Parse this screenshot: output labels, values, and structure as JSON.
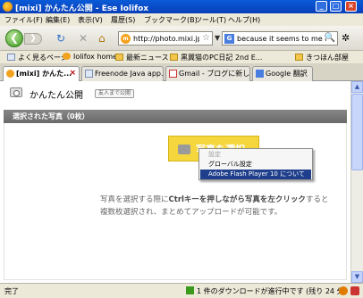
{
  "window": {
    "title": "[mixi] かんたん公開 - Ese Iolifox",
    "minimize_glyph": "_",
    "maximize_glyph": "□",
    "close_glyph": "×"
  },
  "menubar": [
    "ファイル(F)",
    "編集(E)",
    "表示(V)",
    "履歴(S)",
    "ブックマーク(B)",
    "ツール(T)",
    "ヘルプ(H)"
  ],
  "navbar": {
    "back_glyph": "❮",
    "forward_glyph": "❯",
    "reload_glyph": "↻",
    "stop_glyph": "✕",
    "home_glyph": "⌂",
    "url": "http://photo.mixi.jp",
    "url_favicon_text": "m",
    "star_glyph": "☆",
    "search_text": "because it seems to me a",
    "search_engine_icon_text": "G",
    "search_glyph": "🔍",
    "options_glyph": "✲"
  },
  "bookmarks": [
    {
      "label": "よく見るページ",
      "icon": "bookmark-page-icon"
    },
    {
      "label": "Iolifox home",
      "icon": "bookmark-folder-icon"
    },
    {
      "label": "最新ニュース",
      "icon": "bookmark-folder-icon"
    },
    {
      "label": "黒翼猫のPC日記 2nd E...",
      "icon": "bookmark-folder-icon"
    },
    {
      "label": "きつほん部屋",
      "icon": "bookmark-folder-icon"
    }
  ],
  "tabs": [
    {
      "label": "[mixi] かんた...",
      "active": true
    },
    {
      "label": "Freenode Java app...",
      "active": false
    },
    {
      "label": "Gmail - ブログに新し...",
      "active": false
    },
    {
      "label": "Google 翻訳",
      "active": false
    }
  ],
  "page": {
    "title": "かんたん公開",
    "badge": "友人まで公開",
    "section_title": "選択された写真（0枚）",
    "select_button": "写真を選択",
    "hint_line1_a": "写真を選択する際に",
    "hint_line1_b": "Ctrlキーを押しながら写真を左クリック",
    "hint_line1_c": "すると",
    "hint_line2": "複数枚選択され、まとめてアップロードが可能です。"
  },
  "context_menu": {
    "items": [
      {
        "label": "設定",
        "disabled": true
      },
      {
        "label": "グローバル設定",
        "disabled": false
      },
      {
        "label": "Adobe Flash Player 10 について",
        "highlighted": true
      }
    ]
  },
  "statusbar": {
    "left": "完了",
    "download": "1 件のダウンロードが進行中です (残り 24 分)"
  },
  "colors": {
    "titlebar": "#0a5ad8",
    "section_bar": "#6a6a6a",
    "select_button": "#f5d63d",
    "menu_highlight": "#1f3f8c"
  }
}
